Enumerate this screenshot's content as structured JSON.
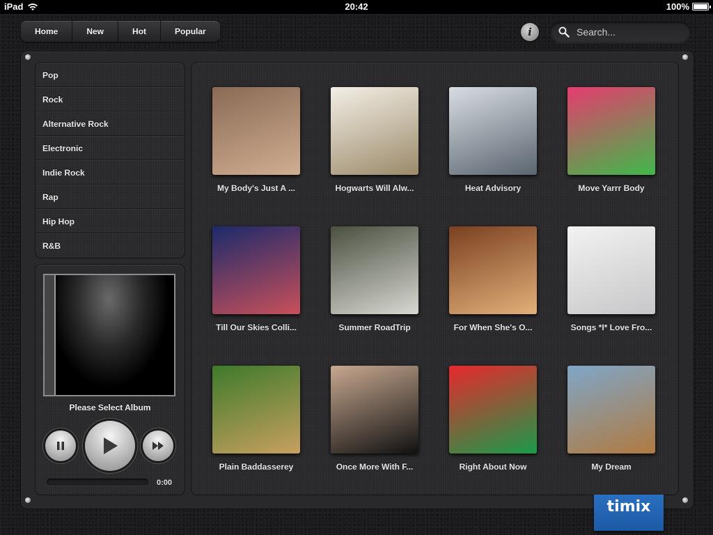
{
  "status_bar": {
    "device": "iPad",
    "time": "20:42",
    "battery": "100%",
    "battery_level": 1.0
  },
  "nav": {
    "items": [
      "Home",
      "New",
      "Hot",
      "Popular"
    ]
  },
  "info": {
    "label": "i",
    "icon": "info-icon"
  },
  "search": {
    "placeholder": "Search...",
    "value": "",
    "icon": "search-icon"
  },
  "genres": [
    "Pop",
    "Rock",
    "Alternative Rock",
    "Electronic",
    "Indie Rock",
    "Rap",
    "Hip Hop",
    "R&B"
  ],
  "player": {
    "now_playing": "Please Select Album",
    "time": "0:00",
    "progress": 0,
    "controls": [
      "pause-icon",
      "play-icon",
      "fast-forward-icon"
    ]
  },
  "albums": [
    {
      "title": "My Body's Just A ...",
      "colors": [
        "#8b6a55",
        "#cfae92"
      ]
    },
    {
      "title": "Hogwarts Will Alw...",
      "colors": [
        "#f3efe6",
        "#9b8a6a"
      ]
    },
    {
      "title": "Heat Advisory",
      "colors": [
        "#d8dde2",
        "#5b6570"
      ]
    },
    {
      "title": "Move Yarrr Body",
      "colors": [
        "#e63c6e",
        "#3fb84a"
      ]
    },
    {
      "title": "Till Our Skies Colli...",
      "colors": [
        "#1c2a6b",
        "#c8505a"
      ]
    },
    {
      "title": "Summer RoadTrip",
      "colors": [
        "#4a5040",
        "#d8d8d2"
      ]
    },
    {
      "title": "For When She's O...",
      "colors": [
        "#7a4020",
        "#e2b07a"
      ]
    },
    {
      "title": "Songs *I* Love Fro...",
      "colors": [
        "#f2f2f2",
        "#c7c7c9"
      ]
    },
    {
      "title": "Plain Baddasserey",
      "colors": [
        "#3d7a2a",
        "#c8a060"
      ]
    },
    {
      "title": "Once More With F...",
      "colors": [
        "#c8a890",
        "#111111"
      ]
    },
    {
      "title": "Right About Now",
      "colors": [
        "#e8282c",
        "#1a9a4a"
      ]
    },
    {
      "title": "My Dream",
      "colors": [
        "#7fa6c8",
        "#b07a40"
      ]
    }
  ],
  "logo": {
    "text": "timix",
    "color": "#2266b5"
  }
}
